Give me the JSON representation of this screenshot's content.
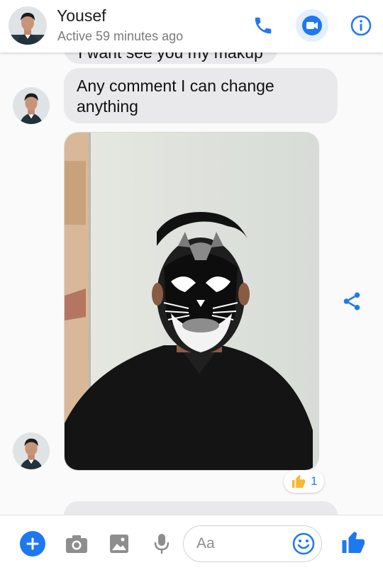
{
  "header": {
    "contact_name": "Yousef",
    "status": "Active 59 minutes ago"
  },
  "messages": {
    "partial_top": "I want see you my makup",
    "main_text": "Any comment I can change anything",
    "reaction_count": "1"
  },
  "composer": {
    "placeholder": "Aa"
  },
  "colors": {
    "accent": "#1e78f0",
    "bubble": "#e9e9eb"
  }
}
